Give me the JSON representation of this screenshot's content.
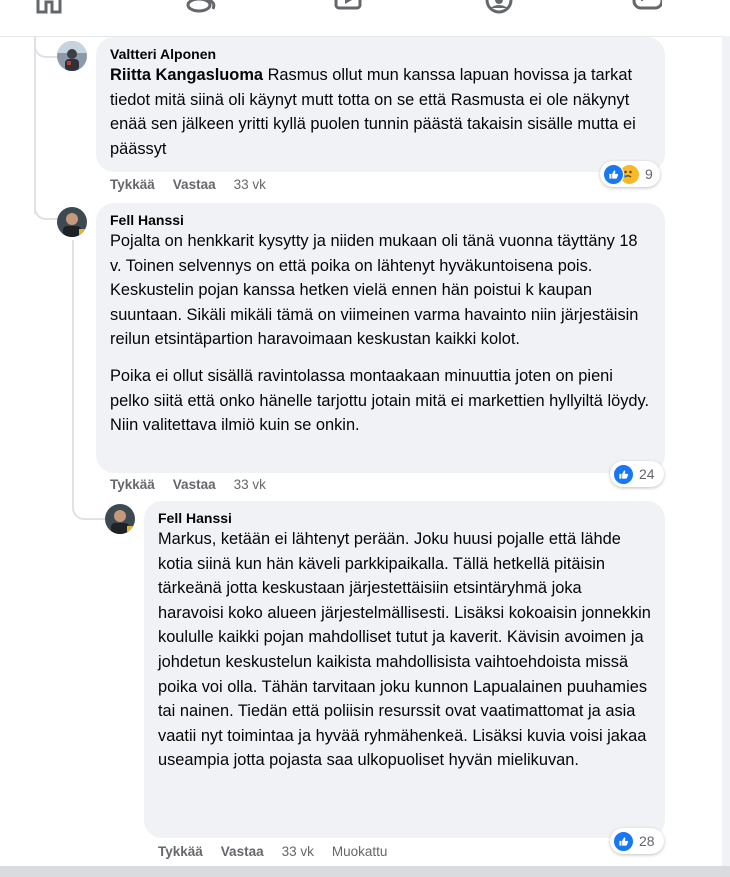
{
  "nav": {
    "icons": [
      "home-icon",
      "friends-icon",
      "watch-icon",
      "groups-icon",
      "gaming-icon"
    ]
  },
  "comments": [
    {
      "author": "Valtteri Alponen",
      "mention": "Riitta Kangasluoma",
      "text": "Rasmus ollut mun kanssa lapuan hovissa ja tarkat tiedot mitä siinä oli käynyt mutt totta on se että Rasmusta ei ole näkynyt enää sen jälkeen yritti kyllä puolen tunnin päästä takaisin sisälle mutta ei päässyt",
      "like_label": "Tykkää",
      "reply_label": "Vastaa",
      "time": "33 vk",
      "reactions": [
        "like",
        "sad"
      ],
      "reaction_count": "9"
    },
    {
      "author": "Fell Hanssi",
      "paragraphs": [
        "Pojalta on henkkarit kysytty ja niiden mukaan oli tänä vuonna täyttäny 18 v. Toinen selvennys on että poika on lähtenyt hyväkuntoisena pois. Keskustelin pojan kanssa hetken vielä ennen hän poistui k kaupan suuntaan. Sikäli mikäli tämä on viimeinen varma havainto niin järjestäisin reilun etsintäpartion haravoimaan keskustan kaikki kolot.",
        "Poika ei ollut sisällä ravintolassa montaakaan minuuttia joten on pieni pelko siitä että onko hänelle tarjottu jotain mitä ei markettien hyllyiltä löydy. Niin valitettava ilmiö kuin se onkin."
      ],
      "like_label": "Tykkää",
      "reply_label": "Vastaa",
      "time": "33 vk",
      "reactions": [
        "like"
      ],
      "reaction_count": "24"
    },
    {
      "author": "Fell Hanssi",
      "text": "Markus, ketään ei lähtenyt perään. Joku huusi pojalle että lähde kotia siinä kun hän käveli parkkipaikalla. Tällä hetkellä pitäisin tärkeänä jotta keskustaan järjestettäisiin etsintäryhmä joka haravoisi koko alueen järjestelmällisesti. Lisäksi kokoaisin jonnekkin koululle kaikki pojan mahdolliset tutut ja kaverit. Kävisin avoimen ja johdetun keskustelun kaikista mahdollisista vaihtoehdoista missä poika voi olla. Tähän tarvitaan joku kunnon Lapualainen puuhamies tai nainen. Tiedän että poliisin resurssit ovat vaatimattomat ja asia vaatii nyt toimintaa ja hyvää ryhmähenkeä. Lisäksi kuvia voisi jakaa useampia jotta pojasta saa ulkopuoliset hyvän mielikuvan.",
      "like_label": "Tykkää",
      "reply_label": "Vastaa",
      "time": "33 vk",
      "edited_label": "Muokattu",
      "reactions": [
        "like"
      ],
      "reaction_count": "28"
    }
  ]
}
